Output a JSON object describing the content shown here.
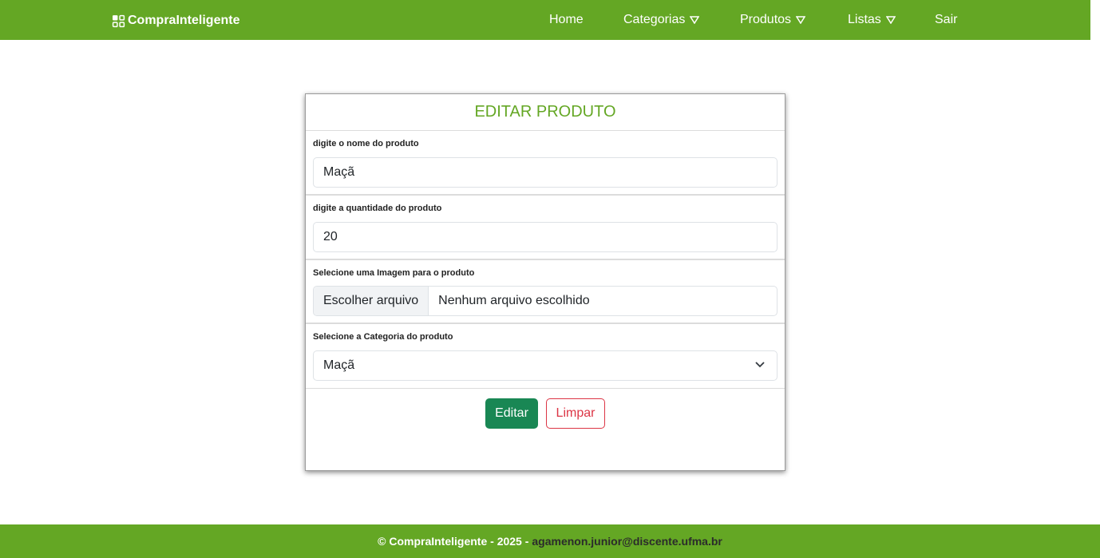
{
  "navbar": {
    "brand": "CompraInteligente",
    "brand_icon": "grid-icon",
    "items": [
      {
        "label": "Home"
      },
      {
        "label": "Categorias"
      },
      {
        "label": "Produtos"
      },
      {
        "label": "Listas"
      },
      {
        "label": "Sair"
      }
    ]
  },
  "form": {
    "title": "EDITAR PRODUTO",
    "name_label": "digite o nome do produto",
    "name_value": "Maçã",
    "qty_label": "digite a quantidade do produto",
    "qty_value": "20",
    "image_label": "Selecione uma Imagem para o produto",
    "file_button": "Escolher arquivo",
    "file_status": "Nenhum arquivo escolhido",
    "category_label": "Selecione a Categoria do produto",
    "category_value": "Maçã",
    "edit_button": "Editar",
    "clear_button": "Limpar"
  },
  "footer": {
    "copyright": "© CompraInteligente - 2025 -",
    "email": "agamenon.junior@discente.ufma.br"
  },
  "colors": {
    "brand_green": "#64a724",
    "edit_green": "#198754",
    "clear_red": "#dc3545"
  }
}
